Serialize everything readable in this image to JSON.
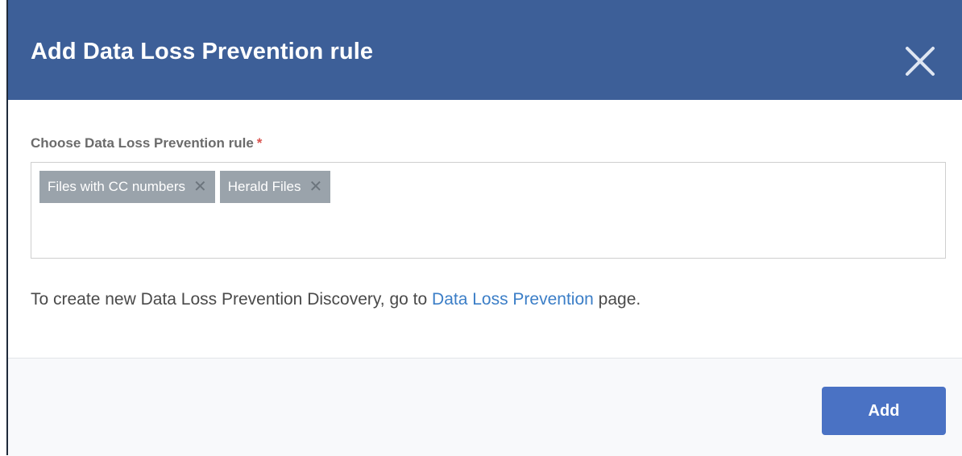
{
  "dialog": {
    "title": "Add Data Loss Prevention rule",
    "close_icon": "close-icon"
  },
  "form": {
    "field_label": "Choose Data Loss Prevention rule",
    "required_marker": "*",
    "tags": [
      {
        "label": "Files with CC numbers",
        "remove_symbol": "✕"
      },
      {
        "label": "Herald Files",
        "remove_symbol": "✕"
      }
    ]
  },
  "help": {
    "prefix": "To create new Data Loss Prevention Discovery, go to ",
    "link_text": "Data Loss Prevention",
    "suffix": " page."
  },
  "footer": {
    "add_label": "Add"
  },
  "colors": {
    "header": "#3d5f98",
    "tag": "#9aa3ab",
    "link": "#3b7ec7",
    "button": "#4a72c4",
    "required": "#d9534f"
  }
}
